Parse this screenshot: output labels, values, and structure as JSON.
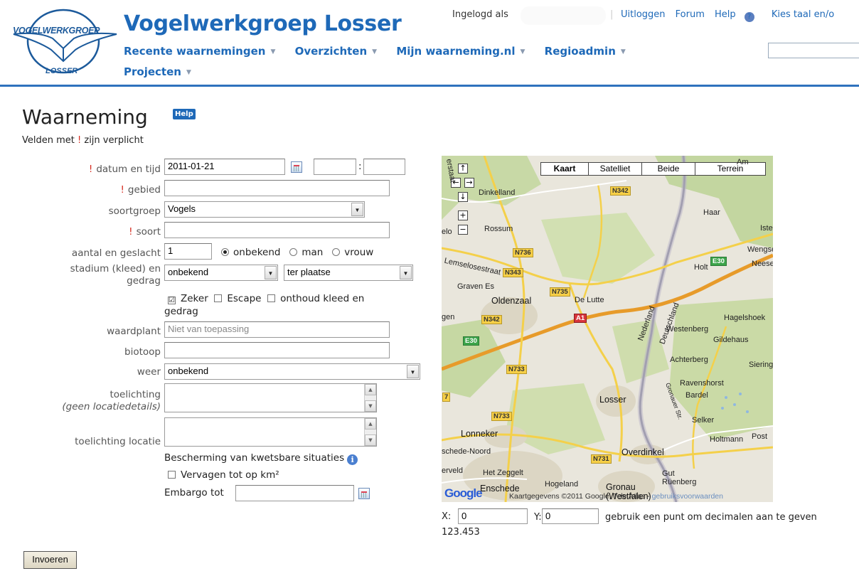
{
  "header": {
    "logo_top": "VOGELWERKGROEP",
    "logo_bottom": "LOSSER",
    "site_title": "Vogelwerkgroep Losser",
    "logged_in_label": "Ingelogd als",
    "links": {
      "logout": "Uitloggen",
      "forum": "Forum",
      "help": "Help",
      "language": "Kies taal en/o"
    },
    "nav_row1": [
      "Recente waarnemingen",
      "Overzichten",
      "Mijn waarneming.nl",
      "Regioadmin"
    ],
    "nav_row2": [
      "Projecten"
    ],
    "nav_arrow": "▼"
  },
  "page": {
    "title": "Waarneming",
    "help_badge": "Help",
    "required_note_pre": "Velden met",
    "required_mark": "!",
    "required_note_post": "zijn verplicht"
  },
  "form": {
    "datum_label": "datum en tijd",
    "datum_value": "2011-01-21",
    "time_hour": "",
    "time_min": "",
    "time_sep": ":",
    "gebied_label": "gebied",
    "gebied_value": "",
    "soortgroep_label": "soortgroep",
    "soortgroep_value": "Vogels",
    "soort_label": "soort",
    "soort_value": "",
    "aantal_label": "aantal en geslacht",
    "aantal_value": "1",
    "sex_options": [
      "onbekend",
      "man",
      "vrouw"
    ],
    "sex_selected": "onbekend",
    "stadium_label_1": "stadium (kleed) en",
    "stadium_label_2": "gedrag",
    "stadium_value": "onbekend",
    "gedrag_value": "ter plaatse",
    "check_zeker": "Zeker",
    "check_escape": "Escape",
    "check_onthoud": "onthoud kleed en",
    "check_onthoud_2": "gedrag",
    "checked_mark": "☑",
    "waardplant_label": "waardplant",
    "waardplant_placeholder": "Niet van toepassing",
    "biotoop_label": "biotoop",
    "biotoop_value": "",
    "weer_label": "weer",
    "weer_value": "onbekend",
    "toelichting_label": "toelichting",
    "toelichting_sub": "(geen locatiedetails)",
    "toelichting_locatie_label": "toelichting locatie",
    "bescherming_text": "Bescherming van kwetsbare situaties",
    "vervagen_text": "Vervagen tot op km²",
    "embargo_label": "Embargo tot",
    "embargo_value": "",
    "submit_label": "Invoeren"
  },
  "map": {
    "types": [
      "Kaart",
      "Satelliet",
      "Beide",
      "Terrein"
    ],
    "active_type": "Kaart",
    "controls": {
      "up": "↑",
      "left": "←",
      "right": "→",
      "down": "↓",
      "zoom_in": "+",
      "zoom_out": "−"
    },
    "places": [
      "Dinkelland",
      "Rossum",
      "Haar",
      "Iste",
      "Wengse",
      "Neese",
      "Holt",
      "Lemselosestraat",
      "Graven Es",
      "Oldenzaal",
      "De Lutte",
      "Hagelshoek",
      "Westenberg",
      "Gildehaus",
      "Achterberg",
      "Siering",
      "Ravenshorst",
      "Bardel",
      "Losser",
      "Selker",
      "Holtmann",
      "Post",
      "Lonneker",
      "schede-Noord",
      "Overdinkel",
      "Het Zeggelt",
      "erveld",
      "Gut Rüenberg",
      "Enschede",
      "Hogeland",
      "Gronau (Westfalen)",
      "Nederland",
      "Deutschland",
      "gen",
      "elo",
      "erstaat",
      "Am",
      "Gronauer Str."
    ],
    "roads": [
      "N342",
      "N736",
      "N343",
      "N735",
      "A1",
      "N342",
      "E30",
      "E30",
      "N733",
      "N733",
      "N731",
      "7"
    ],
    "google": "Google",
    "attribution": "Kaartgegevens ©2011 Google, Tele Atlas -",
    "terms": "gebruiksvoorwaarden"
  },
  "coords": {
    "x_label": "X:",
    "x_value": "0",
    "y_label": "Y:",
    "y_value": "0",
    "hint": "gebruik een punt om decimalen aan te geven",
    "example": "123.453"
  }
}
